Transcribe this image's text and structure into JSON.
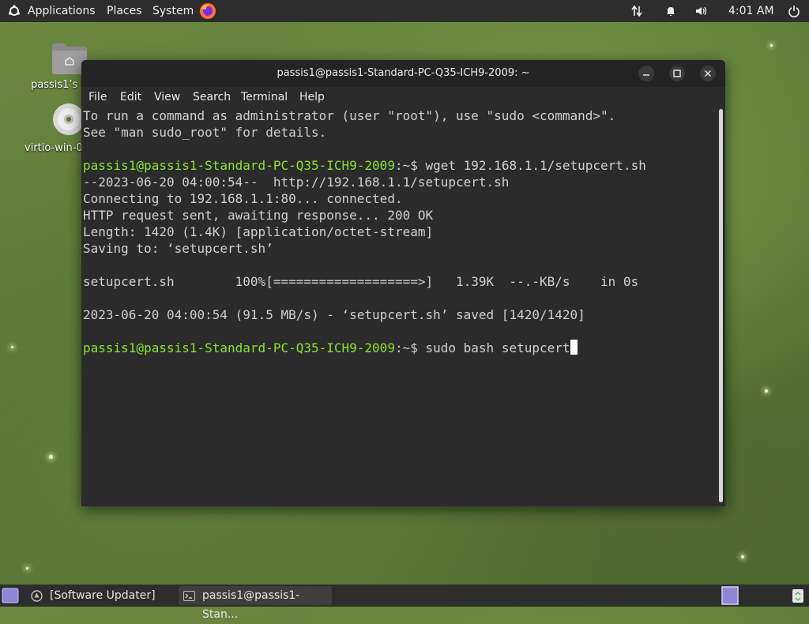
{
  "top_panel": {
    "menus": [
      "Applications",
      "Places",
      "System"
    ],
    "clock": "4:01 AM"
  },
  "desktop": {
    "icons": [
      {
        "label": "passis1’s H",
        "icon": "home-folder-icon"
      },
      {
        "label": "virtio-win-0",
        "icon": "cd-drive-icon"
      }
    ]
  },
  "terminal": {
    "title": "passis1@passis1-Standard-PC-Q35-ICH9-2009: ~",
    "menu": [
      "File",
      "Edit",
      "View",
      "Search",
      "Terminal",
      "Help"
    ],
    "prompt_user": "passis1@passis1-Standard-PC-Q35-ICH9-2009",
    "prompt_suffix": ":~$ ",
    "lines": {
      "intro1": "To run a command as administrator (user \"root\"), use \"sudo <command>\".",
      "intro2": "See \"man sudo_root\" for details.",
      "cmd1": "wget 192.168.1.1/setupcert.sh",
      "out1": "--2023-06-20 04:00:54--  http://192.168.1.1/setupcert.sh",
      "out2": "Connecting to 192.168.1.1:80... connected.",
      "out3": "HTTP request sent, awaiting response... 200 OK",
      "out4": "Length: 1420 (1.4K) [application/octet-stream]",
      "out5": "Saving to: ‘setupcert.sh’",
      "progress": "setupcert.sh        100%[===================>]   1.39K  --.-KB/s    in 0s",
      "saved": "2023-06-20 04:00:54 (91.5 MB/s) - ‘setupcert.sh’ saved [1420/1420]",
      "cmd2": "sudo bash setupcert"
    }
  },
  "taskbar": {
    "tasks": [
      "[Software Updater]",
      "passis1@passis1-Stan..."
    ]
  },
  "colors": {
    "prompt_green": "#8ae234",
    "terminal_bg": "#2b2b2b",
    "panel_bg": "#2d2d2d"
  }
}
